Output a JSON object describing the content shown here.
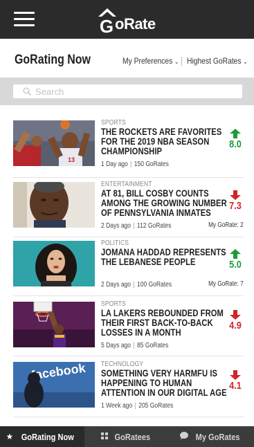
{
  "header": {
    "logo_text": "oRate",
    "logo_letter": "G"
  },
  "subheader": {
    "title": "GoRating Now",
    "filter_preferences": "My Preferences",
    "filter_sort": "Highest GoRates"
  },
  "search": {
    "placeholder": "Search",
    "value": ""
  },
  "feed": [
    {
      "category": "SPORTS",
      "headline": "THE ROCKETS ARE FAVORITES FOR THE 2019 NBA SEASON CHAMPIONSHIP",
      "age": "1 Day ago",
      "gorates": "150 GoRates",
      "my_gorate": "",
      "score": "8.0",
      "trend": "up"
    },
    {
      "category": "ENTERTAINMENT",
      "headline": "AT 81, BILL COSBY COUNTS AMONG THE GROWING NUMBER OF PENNSYLVANIA INMATES",
      "age": "2 Days ago",
      "gorates": "112 GoRates",
      "my_gorate": "My GoRate: 2",
      "score": "7.3",
      "trend": "down"
    },
    {
      "category": "POLITICS",
      "headline": "JOMANA HADDAD REPRESENTS THE LEBANESE PEOPLE",
      "age": "2 Days ago",
      "gorates": "100 GoRates",
      "my_gorate": "My GoRate: 7",
      "score": "5.0",
      "trend": "up"
    },
    {
      "category": "SPORTS",
      "headline": "LA LAKERS REBOUNDED FROM THEIR FIRST BACK-TO-BACK LOSSES IN A MONTH",
      "age": "5 Days ago",
      "gorates": "85 GoRates",
      "my_gorate": "",
      "score": "4.9",
      "trend": "down"
    },
    {
      "category": "TECHNOLOGY",
      "headline": "SOMETHING VERY HARMFU IS HAPPENING TO HUMAN ATTENTION IN OUR DIGITAL AGE",
      "age": "1 Week ago",
      "gorates": "205 GoRates",
      "my_gorate": "",
      "score": "4.1",
      "trend": "down"
    }
  ],
  "thumb_text": {
    "jersey_number": "13",
    "facebook_sign": "facebook"
  },
  "colors": {
    "up": "#1e9a3c",
    "down": "#d0262a",
    "topbar": "#2b2b2b",
    "bottombar": "#3c3c3c"
  },
  "tabs": [
    {
      "label": "GoRating Now",
      "icon": "star-icon",
      "active": true
    },
    {
      "label": "GoRatees",
      "icon": "grid-icon",
      "active": false
    },
    {
      "label": "My GoRates",
      "icon": "chat-bubble-icon",
      "active": false
    }
  ]
}
